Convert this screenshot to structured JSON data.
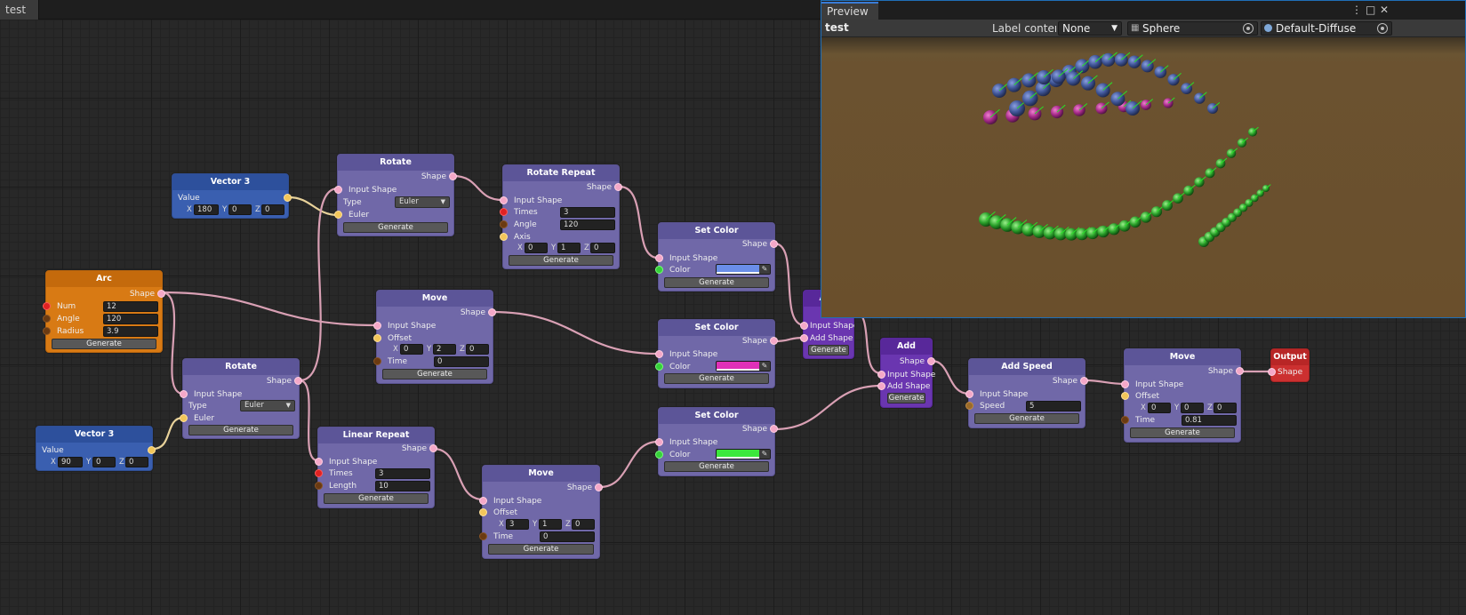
{
  "graph_tab": "test",
  "preview": {
    "tab_label": "Preview",
    "title": "test",
    "label_content_label": "Label conten",
    "label_content_value": "None",
    "mesh_value": "Sphere",
    "material_value": "Default-Diffuse"
  },
  "common": {
    "generate": "Generate",
    "shape": "Shape",
    "input_shape": "Input Shape",
    "add_shape": "Add Shape",
    "value": "Value",
    "type": "Type",
    "euler": "Euler",
    "offset": "Offset",
    "time": "Time",
    "color": "Color",
    "times": "Times",
    "x": "X",
    "y": "Y",
    "z": "Z"
  },
  "nodes": {
    "vector3_top": {
      "title": "Vector 3",
      "x": "180",
      "y": "0",
      "z": "0"
    },
    "vector3_bottom": {
      "title": "Vector 3",
      "x": "90",
      "y": "0",
      "z": "0"
    },
    "arc": {
      "title": "Arc",
      "num_label": "Num",
      "num": "12",
      "angle_label": "Angle",
      "angle": "120",
      "radius_label": "Radius",
      "radius": "3.9"
    },
    "rotate_top": {
      "title": "Rotate",
      "type_value": "Euler"
    },
    "rotate_bottom": {
      "title": "Rotate",
      "type_value": "Euler"
    },
    "rotate_repeat": {
      "title": "Rotate Repeat",
      "times": "3",
      "angle_label": "Angle",
      "angle": "120",
      "axis_label": "Axis",
      "x": "0",
      "y": "1",
      "z": "0"
    },
    "move_mid": {
      "title": "Move",
      "x": "0",
      "y": "2",
      "z": "0",
      "time": "0"
    },
    "move_bottom": {
      "title": "Move",
      "x": "3",
      "y": "1",
      "z": "0",
      "time": "0"
    },
    "move_right": {
      "title": "Move",
      "x": "0",
      "y": "0",
      "z": "0",
      "time": "0.81"
    },
    "linear_repeat": {
      "title": "Linear Repeat",
      "times": "3",
      "length_label": "Length",
      "length": "10"
    },
    "set_color_top": {
      "title": "Set Color",
      "color": "#6a8ee8"
    },
    "set_color_mid": {
      "title": "Set Color",
      "color": "#e030b8"
    },
    "set_color_bottom": {
      "title": "Set Color",
      "color": "#3ce83c"
    },
    "add_hidden": {
      "title": "Add"
    },
    "add": {
      "title": "Add"
    },
    "add_speed": {
      "title": "Add Speed",
      "speed_label": "Speed",
      "speed": "5"
    },
    "output": {
      "title": "Output"
    }
  }
}
